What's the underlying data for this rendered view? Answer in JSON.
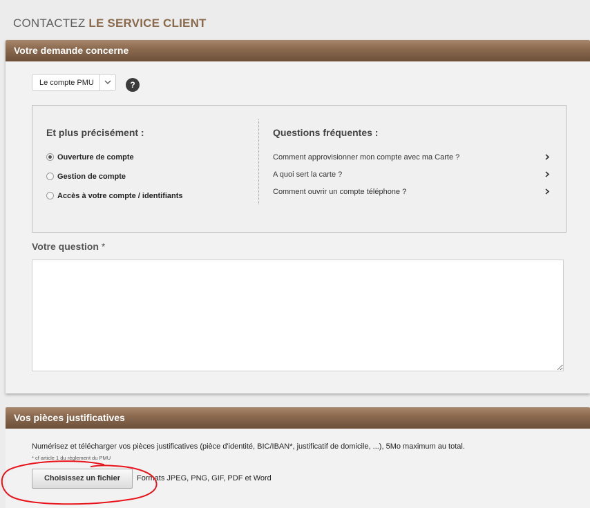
{
  "page": {
    "title_normal": "CONTACTEZ ",
    "title_bold": "LE SERVICE CLIENT"
  },
  "request": {
    "header": "Votre demande concerne",
    "select_value": "Le compte PMU",
    "help_symbol": "?",
    "precisely_title": "Et plus précisément :",
    "options": [
      {
        "label": "Ouverture de compte",
        "checked": true
      },
      {
        "label": "Gestion de compte",
        "checked": false
      },
      {
        "label": "Accès à votre compte / identifiants",
        "checked": false
      }
    ],
    "faq_title": "Questions fréquentes :",
    "faq": [
      "Comment approvisionner mon compte avec ma Carte ?",
      "A quoi sert la carte ?",
      "Comment ouvrir un compte téléphone ?"
    ],
    "question_label": "Votre question",
    "question_required": " *",
    "question_value": ""
  },
  "documents": {
    "header": "Vos pièces justificatives",
    "description": "Numérisez et télécharger vos pièces justificatives (pièce d'identité, BIC/IBAN*, justificatif de domicile, ...), 5Mo maximum au total.",
    "footnote": "* cf article 1 du règlement du PMU",
    "choose_file_label": "Choisissez un fichier",
    "formats": "Formats JPEG, PNG, GIF, PDF et Word"
  },
  "colors": {
    "header_brown": "#8b6a50",
    "title_brown": "#8a6a4c",
    "annotation_red": "#e8131b"
  },
  "icons": {
    "help": "question-circle-icon",
    "select_arrow": "chevron-down-icon",
    "faq_arrow": "chevron-right-icon"
  }
}
